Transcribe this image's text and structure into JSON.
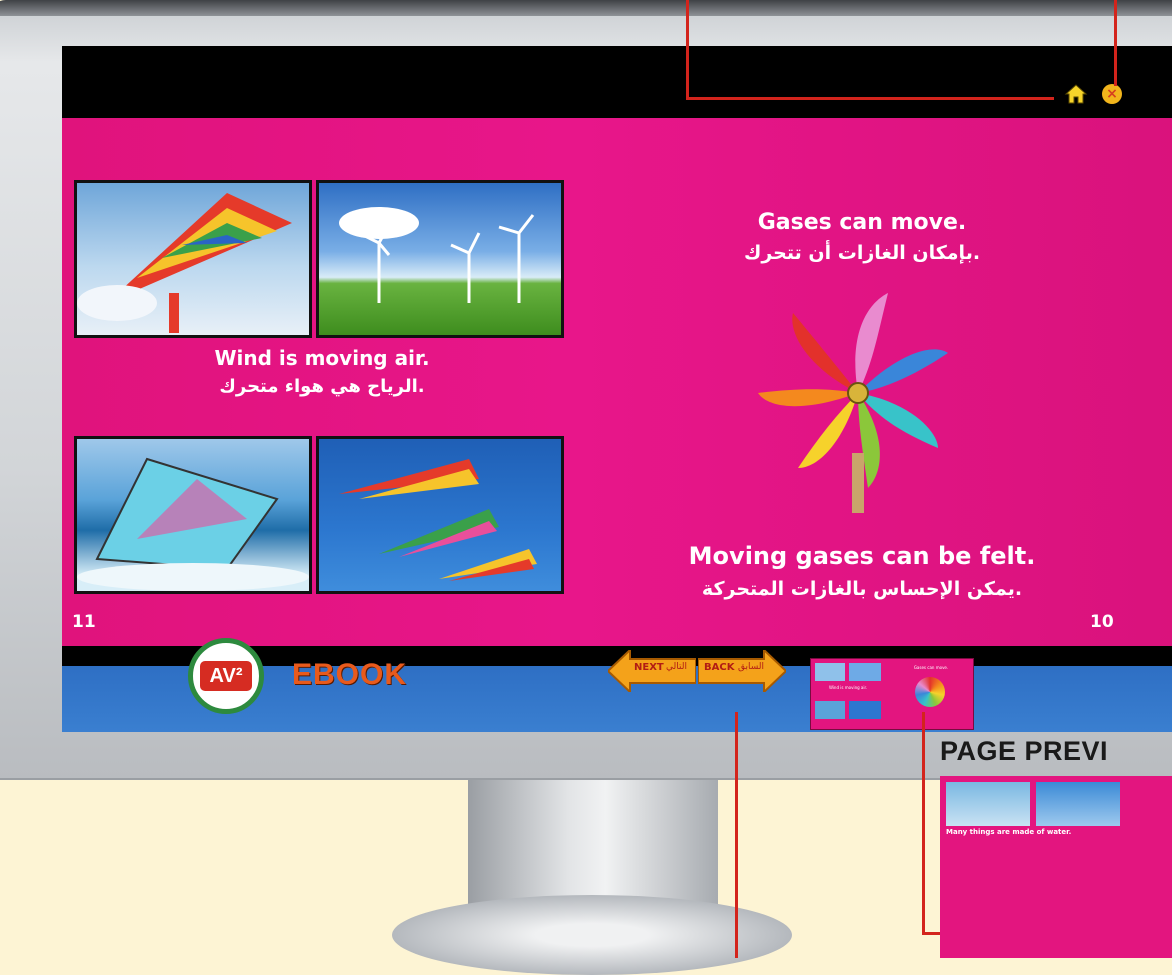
{
  "colors": {
    "page_bg": "#e3157f",
    "topbar": "#000000",
    "toolbar_blue": "#3577c9",
    "arrow_orange": "#f4a21a",
    "ebook_orange": "#e85a1c",
    "callout_red": "#d3241c"
  },
  "spread": {
    "left_page": {
      "caption_en": "Wind is moving air.",
      "caption_ar": "الرياح هي هواء متحرك.",
      "page_number": "11"
    },
    "right_page": {
      "heading_en": "Gases can move.",
      "heading_ar": "بإمكان الغازات أن تتحرك.",
      "caption_en": "Moving gases can be felt.",
      "caption_ar": "يمكن الإحساس بالغازات المتحركة.",
      "page_number": "10"
    }
  },
  "toolbar": {
    "logo_text": "AV²",
    "ebook_label": "EBOOK",
    "next_label": "NEXT",
    "next_ar": "التالي",
    "back_label": "BACK",
    "back_ar": "السابق"
  },
  "icons": {
    "home": "home-icon",
    "close": "close-icon"
  },
  "preview": {
    "heading_en": "Gases can move.",
    "caption_en": "Wind is moving air."
  },
  "callout": {
    "label": "PAGE PREVI",
    "preview_caption": "Many things are made of water."
  }
}
